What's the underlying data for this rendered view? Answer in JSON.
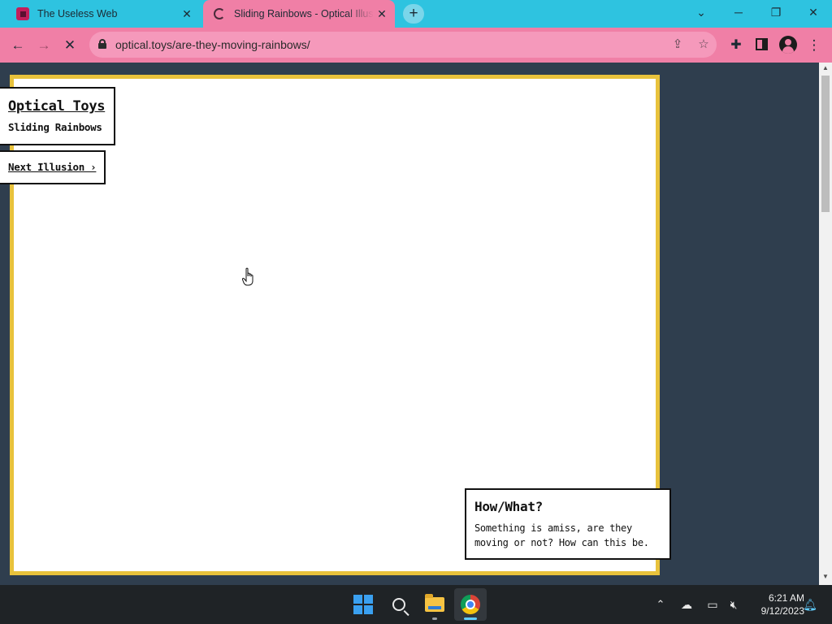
{
  "browser": {
    "tabs": [
      {
        "title": "The Useless Web",
        "active": false
      },
      {
        "title": "Sliding Rainbows - Optical Illusion",
        "active": true,
        "loading": true
      }
    ],
    "new_tab_label": "+",
    "url": "optical.toys/are-they-moving-rainbows/",
    "colors": {
      "tabstrip": "#2ec3e0",
      "toolbar": "#f07fa6",
      "omnibox": "#f599bb"
    },
    "icons": [
      "back-arrow-icon",
      "forward-arrow-icon",
      "stop-loading-icon",
      "lock-icon",
      "share-icon",
      "bookmark-star-icon",
      "extensions-puzzle-icon",
      "side-panel-icon",
      "profile-icon",
      "menu-kebab-icon",
      "tab-search-chevron-icon",
      "minimize-icon",
      "restore-icon",
      "close-window-icon"
    ]
  },
  "page": {
    "brand": {
      "title": "Optical Toys",
      "subtitle": "Sliding Rainbows"
    },
    "next_link": "Next Illusion ›",
    "info": {
      "title": "How/What?",
      "text_line1": "Something is amiss, are they",
      "text_line2": "moving or not? How can this be."
    },
    "colors": {
      "frame_border": "#e8c23c",
      "page_background": "#2f3e4e",
      "canvas": "#ffffff"
    }
  },
  "taskbar": {
    "apps": [
      "windows-start-icon",
      "search-icon",
      "file-explorer-icon",
      "chrome-icon"
    ],
    "time": "6:21 AM",
    "date": "9/12/2023",
    "tray_icons": [
      "show-hidden-icons-chevron",
      "onedrive-cloud-icon",
      "network-icon",
      "volume-muted-icon",
      "notifications-bell-icon"
    ]
  }
}
